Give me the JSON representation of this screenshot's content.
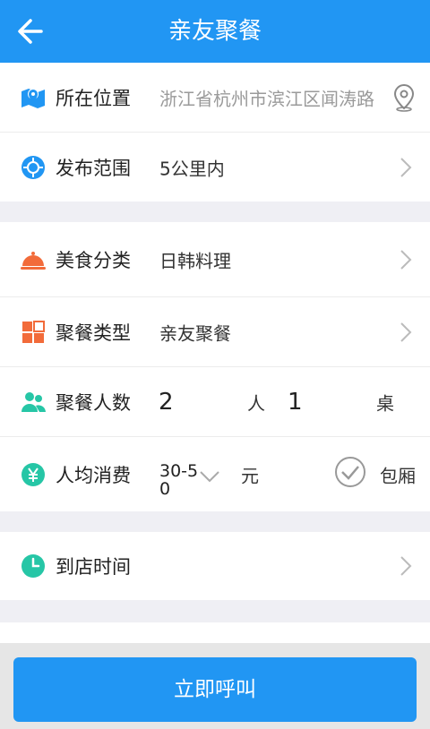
{
  "header": {
    "title": "亲友聚餐"
  },
  "location": {
    "label": "所在位置",
    "value": "浙江省杭州市滨江区闻涛路"
  },
  "range": {
    "label": "发布范围",
    "value": "5公里内"
  },
  "cuisine": {
    "label": "美食分类",
    "value": "日韩料理"
  },
  "party_type": {
    "label": "聚餐类型",
    "value": "亲友聚餐"
  },
  "party_size": {
    "label": "聚餐人数",
    "people": "2",
    "people_unit": "人",
    "tables": "1",
    "tables_unit": "桌"
  },
  "budget": {
    "label": "人均消费",
    "value": "30-50",
    "unit": "元",
    "private_room": "包厢"
  },
  "arrival": {
    "label": "到店时间"
  },
  "actions": {
    "call": "立即呼叫"
  },
  "colors": {
    "primary": "#2196f3",
    "orange": "#f26b3a",
    "teal": "#26c6a6"
  }
}
